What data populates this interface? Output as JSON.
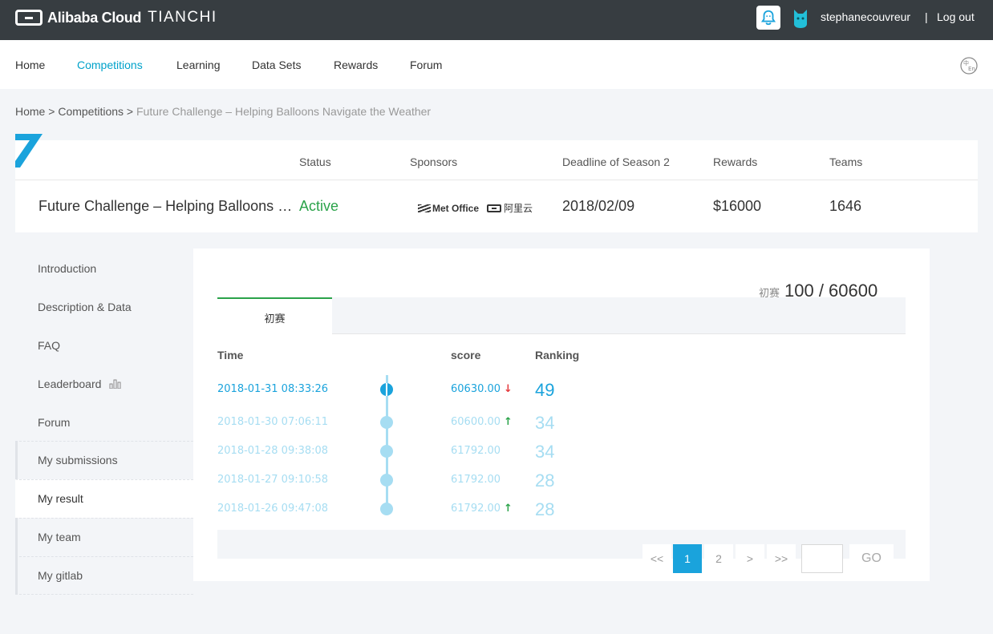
{
  "topbar": {
    "logo_text": "Alibaba Cloud",
    "logo_product": "TIANCHI",
    "username": "stephanecouvreur",
    "separator": "|",
    "logout": "Log out"
  },
  "nav": {
    "items": [
      {
        "label": "Home"
      },
      {
        "label": "Competitions"
      },
      {
        "label": "Learning"
      },
      {
        "label": "Data Sets"
      },
      {
        "label": "Rewards"
      },
      {
        "label": "Forum"
      }
    ],
    "active": "Competitions"
  },
  "breadcrumb": {
    "home": "Home",
    "sep1": ">",
    "competitions": "Competitions",
    "sep2": ">",
    "current": "Future Challenge – Helping Balloons Navigate the Weather"
  },
  "competition": {
    "headers": {
      "status": "Status",
      "sponsors": "Sponsors",
      "deadline": "Deadline of Season 2",
      "rewards": "Rewards",
      "teams": "Teams"
    },
    "title": "Future Challenge – Helping Balloons Navigate the Weather",
    "status": "Active",
    "sponsor1": "Met Office",
    "sponsor2": "阿里云",
    "deadline": "2018/02/09",
    "rewards": "$16000",
    "teams": "1646"
  },
  "sidebar": {
    "items": [
      {
        "label": "Introduction"
      },
      {
        "label": "Description & Data"
      },
      {
        "label": "FAQ"
      },
      {
        "label": "Leaderboard"
      },
      {
        "label": "Forum"
      }
    ],
    "blocks": [
      {
        "label": "My submissions"
      },
      {
        "label": "My result"
      },
      {
        "label": "My team"
      },
      {
        "label": "My gitlab"
      }
    ],
    "selected": "My result"
  },
  "result": {
    "stage_label": "初赛",
    "quota": "100 / 60600",
    "tab": "初赛",
    "columns": {
      "time": "Time",
      "score": "score",
      "ranking": "Ranking"
    },
    "rows": [
      {
        "time": "2018-01-31 08:33:26",
        "score": "60630.00",
        "trend": "down",
        "rank": "49"
      },
      {
        "time": "2018-01-30 07:06:11",
        "score": "60600.00",
        "trend": "up",
        "rank": "34"
      },
      {
        "time": "2018-01-28 09:38:08",
        "score": "61792.00",
        "trend": "",
        "rank": "34"
      },
      {
        "time": "2018-01-27 09:10:58",
        "score": "61792.00",
        "trend": "",
        "rank": "28"
      },
      {
        "time": "2018-01-26 09:47:08",
        "score": "61792.00",
        "trend": "up",
        "rank": "28"
      }
    ],
    "pager": {
      "first": "<<",
      "page1": "1",
      "page2": "2",
      "next": ">",
      "last": ">>",
      "input_value": "",
      "go": "GO",
      "current_page": 1
    }
  },
  "colors": {
    "accent": "#00a2ca",
    "active_green": "#2ba34a",
    "topbar": "#373d41",
    "timeline_light": "#a6ddf2",
    "timeline_dark": "#1aa3dc",
    "down_red": "#e4393c"
  },
  "icons": {
    "bell": "bell-icon",
    "avatar": "cat-avatar-icon",
    "language": "language-switch-icon",
    "leaderboard": "bar-chart-icon",
    "trend_down": "arrow-down-icon",
    "trend_up": "arrow-up-icon"
  }
}
